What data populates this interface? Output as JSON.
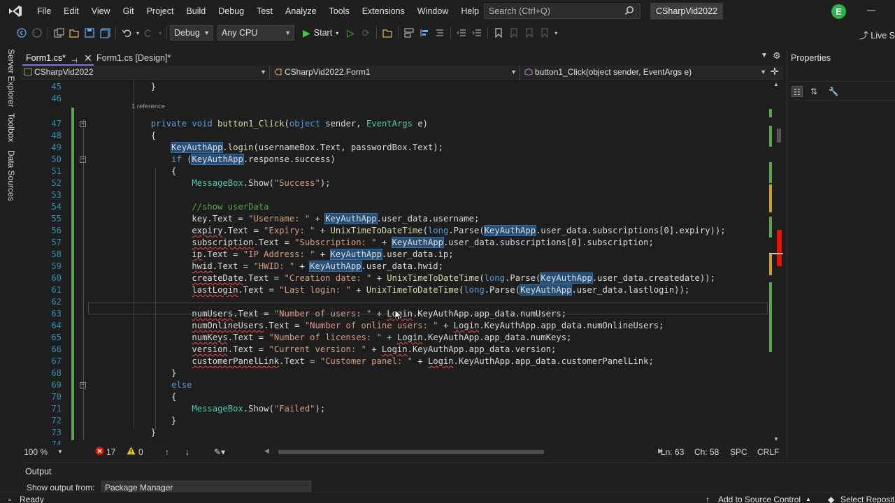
{
  "menu": {
    "items": [
      "File",
      "Edit",
      "View",
      "Git",
      "Project",
      "Build",
      "Debug",
      "Test",
      "Analyze",
      "Tools",
      "Extensions",
      "Window",
      "Help"
    ],
    "search_placeholder": "Search (Ctrl+Q)",
    "solution_title": "CSharpVid2022",
    "user_initial": "E"
  },
  "toolbar": {
    "config": "Debug",
    "platform": "Any CPU",
    "start_label": "Start",
    "live_share": "Live S"
  },
  "left_tabs": [
    "Server Explorer",
    "Toolbox",
    "Data Sources"
  ],
  "doc_tabs": {
    "active": "Form1.cs*",
    "inactive": "Form1.cs [Design]*"
  },
  "navbar": {
    "project": "CSharpVid2022",
    "class": "CSharpVid2022.Form1",
    "member": "button1_Click(object sender, EventArgs e)"
  },
  "code": {
    "reference_hint": "1 reference",
    "lines": [
      {
        "n": "45",
        "text": "        }"
      },
      {
        "n": "46",
        "text": ""
      },
      {
        "n": "47",
        "text": "        private void button1_Click(object sender, EventArgs e)"
      },
      {
        "n": "48",
        "text": "        {"
      },
      {
        "n": "49",
        "text": "            KeyAuthApp.login(usernameBox.Text, passwordBox.Text);"
      },
      {
        "n": "50",
        "text": "            if (KeyAuthApp.response.success)"
      },
      {
        "n": "51",
        "text": "            {"
      },
      {
        "n": "52",
        "text": "                MessageBox.Show(\"Success\");"
      },
      {
        "n": "53",
        "text": ""
      },
      {
        "n": "54",
        "text": "                //show userData"
      },
      {
        "n": "55",
        "text": "                key.Text = \"Username: \" + KeyAuthApp.user_data.username;"
      },
      {
        "n": "56",
        "text": "                expiry.Text = \"Expiry: \" + UnixTimeToDateTime(long.Parse(KeyAuthApp.user_data.subscriptions[0].expiry));"
      },
      {
        "n": "57",
        "text": "                subscription.Text = \"Subscription: \" + KeyAuthApp.user_data.subscriptions[0].subscription;"
      },
      {
        "n": "58",
        "text": "                ip.Text = \"IP Address: \" + KeyAuthApp.user_data.ip;"
      },
      {
        "n": "59",
        "text": "                hwid.Text = \"HWID: \" + KeyAuthApp.user_data.hwid;"
      },
      {
        "n": "60",
        "text": "                createDate.Text = \"Creation date: \" + UnixTimeToDateTime(long.Parse(KeyAuthApp.user_data.createdate));"
      },
      {
        "n": "61",
        "text": "                lastLogin.Text = \"Last login: \" + UnixTimeToDateTime(long.Parse(KeyAuthApp.user_data.lastlogin));"
      },
      {
        "n": "62",
        "text": ""
      },
      {
        "n": "63",
        "text": "                numUsers.Text = \"Number of users: \" + Login.KeyAuthApp.app_data.numUsers;"
      },
      {
        "n": "64",
        "text": "                numOnlineUsers.Text = \"Number of online users: \" + Login.KeyAuthApp.app_data.numOnlineUsers;"
      },
      {
        "n": "65",
        "text": "                numKeys.Text = \"Number of licenses: \" + Login.KeyAuthApp.app_data.numKeys;"
      },
      {
        "n": "66",
        "text": "                version.Text = \"Current version: \" + Login.KeyAuthApp.app_data.version;"
      },
      {
        "n": "67",
        "text": "                customerPanelLink.Text = \"Customer panel: \" + Login.KeyAuthApp.app_data.customerPanelLink;"
      },
      {
        "n": "68",
        "text": "            }"
      },
      {
        "n": "69",
        "text": "            else"
      },
      {
        "n": "70",
        "text": "            {"
      },
      {
        "n": "71",
        "text": "                MessageBox.Show(\"Failed\");"
      },
      {
        "n": "72",
        "text": "            }"
      },
      {
        "n": "73",
        "text": "        }"
      },
      {
        "n": "74",
        "text": ""
      }
    ]
  },
  "properties": {
    "title": "Properties"
  },
  "editor_status": {
    "zoom": "100 %",
    "errors": "17",
    "warnings": "0",
    "line": "Ln: 63",
    "col": "Ch: 58",
    "spacing": "SPC",
    "line_ending": "CRLF"
  },
  "output": {
    "title": "Output",
    "source_label": "Show output from:",
    "source_value": "Package Manager"
  },
  "statusbar": {
    "ready": "Ready",
    "source_control": "Add to Source Control",
    "select_repo": "Select Reposit"
  },
  "colors": {
    "keyword": "#569cd6",
    "type": "#4ec9b0",
    "string": "#d69d85",
    "comment": "#57a64a",
    "line_number": "#2b91af",
    "highlight": "#264f78"
  }
}
